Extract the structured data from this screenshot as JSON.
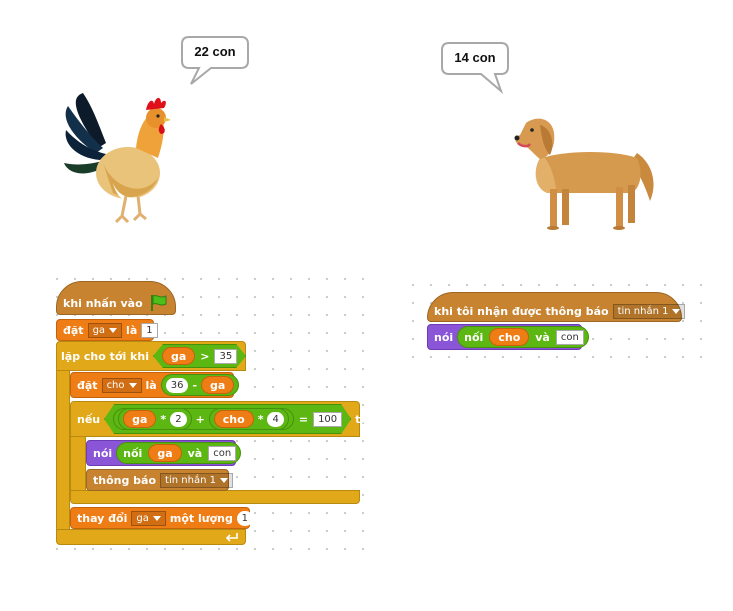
{
  "stage": {
    "rooster_bubble": "22 con",
    "dog_bubble": "14 con"
  },
  "script1": {
    "when_flag": "khi nhấn vào",
    "set_ga": {
      "label": "đặt",
      "var": "ga",
      "to": "là",
      "value": "1"
    },
    "repeat_until": {
      "label": "lặp cho tới khi",
      "var": "ga",
      "op": ">",
      "value": "35"
    },
    "set_cho": {
      "label": "đặt",
      "var": "cho",
      "to": "là",
      "left": "36",
      "op": "-",
      "right_var": "ga"
    },
    "if": {
      "label": "nếu",
      "left_var": "ga",
      "times1": "*",
      "num1": "2",
      "plus": "+",
      "right_var": "cho",
      "times2": "*",
      "num2": "4",
      "eq": "=",
      "target": "100",
      "then": "thì"
    },
    "say": {
      "label": "nói",
      "join": "nối",
      "var": "ga",
      "and": "và",
      "text": "con"
    },
    "broadcast": {
      "label": "thông báo",
      "message": "tin nhắn 1"
    },
    "change": {
      "label": "thay đổi",
      "var": "ga",
      "by": "một lượng",
      "value": "1"
    }
  },
  "script2": {
    "when_receive": {
      "label": "khi tôi nhận được thông báo",
      "message": "tin nhắn 1"
    },
    "say": {
      "label": "nói",
      "join": "nối",
      "var": "cho",
      "and": "và",
      "text": "con"
    }
  },
  "colors": {
    "events": "#c88330",
    "control": "#e1a91a",
    "data": "#ee7d16",
    "looks": "#8a55d7",
    "operators": "#5cb712"
  },
  "icons": [
    "green-flag-icon",
    "repeat-arrow-icon",
    "dropdown-arrow-icon"
  ]
}
